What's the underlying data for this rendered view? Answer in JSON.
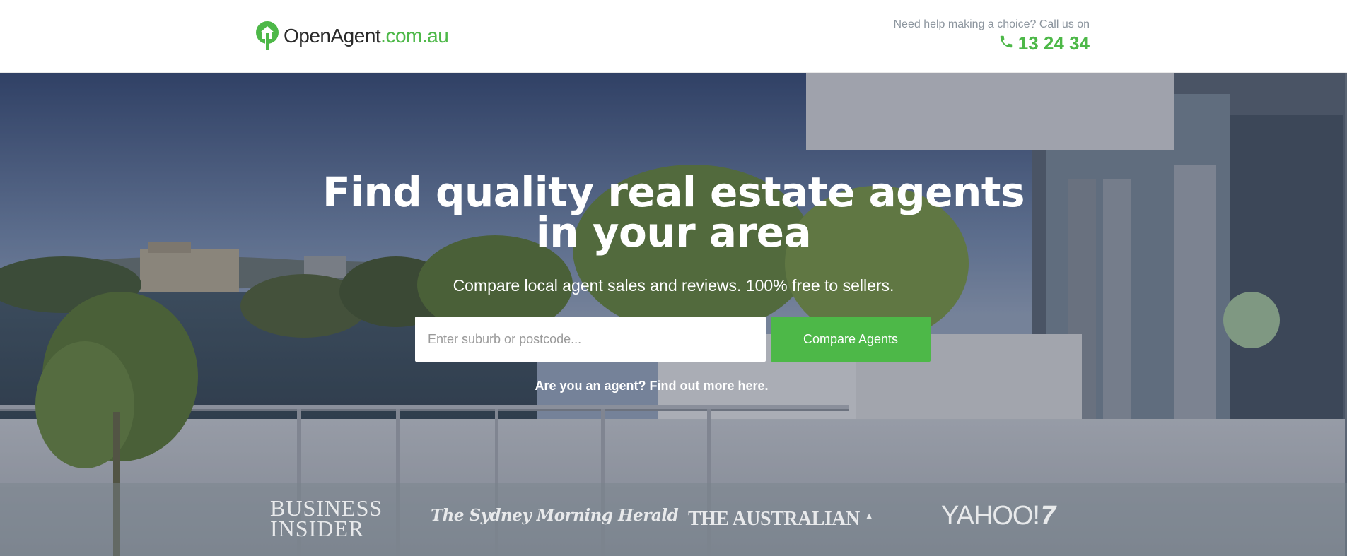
{
  "header": {
    "logo_brand": "OpenAgent",
    "logo_tld": ".com.au",
    "help_text": "Need help making a choice? Call us on",
    "phone": "13 24 34",
    "phone_icon": "phone-icon"
  },
  "hero": {
    "title": "Find quality real estate agents in your area",
    "subtitle": "Compare local agent sales and reviews. 100% free to sellers.",
    "search_placeholder": "Enter suburb or postcode...",
    "search_value": "",
    "compare_label": "Compare Agents",
    "agent_link": "Are you an agent? Find out more here."
  },
  "press": {
    "business_insider_line1": "BUSINESS",
    "business_insider_line2": "INSIDER",
    "smh": "The Sydney Morning Herald",
    "australian": "THE AUSTRALIAN",
    "yahoo": "YAHOO!",
    "yahoo_suffix": "7"
  },
  "colors": {
    "accent": "#4db848",
    "text_muted": "#8c959e",
    "brand_dark": "#2a2a2a"
  }
}
